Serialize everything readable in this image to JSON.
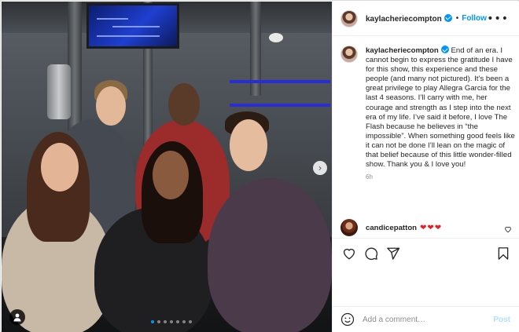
{
  "post": {
    "username": "kaylacheriecompton",
    "follow_label": "Follow",
    "separator": "•",
    "more_label": "•••",
    "caption": "End of an era. I cannot begin to express the gratitude I have for this show, this experience and these people (and many not pictured). It’s been a great privilege to play Allegra Garcia for the last 4 seasons. I’ll carry with me, her courage and strength as I step into the next era of my life. I’ve said it before, I love The Flash because he believes in “the impossible”. When something good feels like it can not be done I’ll lean on the magic of that belief because of this little wonder-filled show. Thank you & I love you!",
    "time_ago": "6h"
  },
  "comments": [
    {
      "username": "candicepatton",
      "text": "❤❤❤"
    }
  ],
  "comment_box": {
    "placeholder": "Add a comment…",
    "post_label": "Post"
  },
  "carousel": {
    "total": 7,
    "active_index": 0
  },
  "icons": {
    "like": "heart-outline-icon",
    "comment": "comment-bubble-icon",
    "share": "paper-plane-icon",
    "save": "bookmark-icon",
    "emoji": "smiley-icon",
    "tag": "person-tag-icon",
    "next": "chevron-right-icon"
  },
  "colors": {
    "accent": "#0095f6",
    "heart": "#ed1c24",
    "post_disabled": "#b2dffc"
  }
}
